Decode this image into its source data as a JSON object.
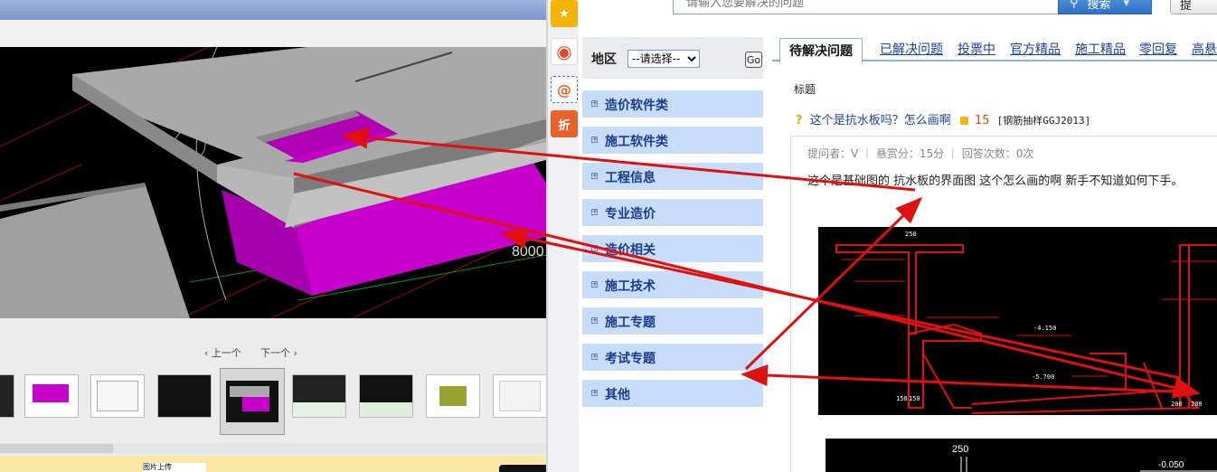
{
  "viewer": {
    "nav_prev": "‹ 上一个",
    "nav_next": "下一个 ›",
    "dimension_label": "8000",
    "bottom_text": "图片上传",
    "thumbnails": 9,
    "selected_thumbnail": 4
  },
  "share_bar": {
    "items": [
      {
        "name": "favorite-star-icon",
        "glyph": "★",
        "color": "#f3b400"
      },
      {
        "name": "weibo-icon",
        "glyph": "◉",
        "color": "#e2492a"
      },
      {
        "name": "email-at-icon",
        "glyph": "@",
        "color": "#e8632b"
      },
      {
        "name": "discount-icon",
        "glyph": "折",
        "color": "#e8632b"
      }
    ]
  },
  "search": {
    "placeholder": "请输入您要解决的问题",
    "button_label": "搜索",
    "ask_label": "提"
  },
  "region": {
    "label": "地区",
    "select_value": "--请选择--",
    "go_label": "Go"
  },
  "categories": [
    "造价软件类",
    "施工软件类",
    "工程信息",
    "专业造价",
    "造价相关",
    "施工技术",
    "施工专题",
    "考试专题",
    "其他"
  ],
  "tabs": [
    "待解决问题",
    "已解决问题",
    "投票中",
    "官方精品",
    "施工精品",
    "零回复",
    "高悬"
  ],
  "list": {
    "column_title": "标题"
  },
  "question": {
    "title": "这个是抗水板吗？怎么画啊",
    "reward": "15",
    "tag": "[钢筋抽样GGJ2013]",
    "meta": "提问者：V  ｜  悬赏分：15分  ｜  回答次数：0次",
    "body": "这个是基础图的  抗水板的界面图  这个怎么画的啊 新手不知道如何下手。"
  },
  "cad": {
    "labels": [
      "250",
      "-4.150",
      "-5.700",
      "150",
      "150",
      "200",
      "200",
      "-0.050"
    ]
  },
  "colors": {
    "accent_blue": "#1d3f96",
    "category_bg": "#c7dcf8",
    "annotation_red": "#e01010",
    "magenta": "#c000c8"
  }
}
